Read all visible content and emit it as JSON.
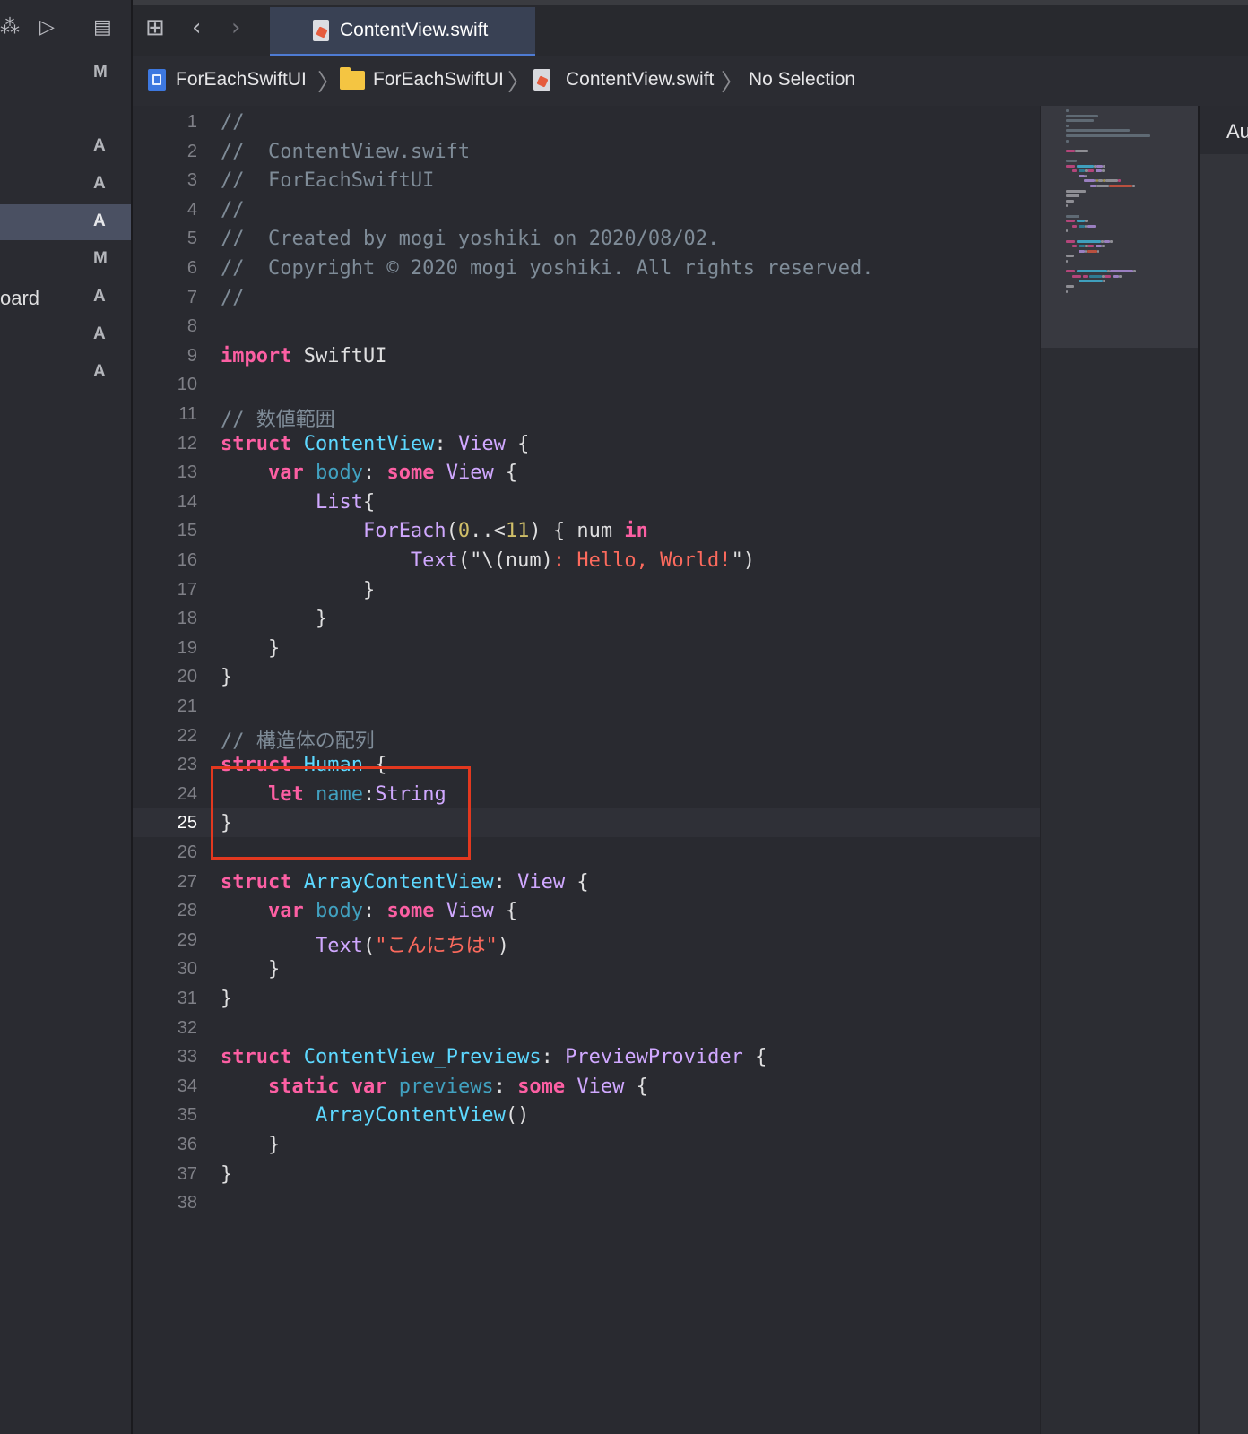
{
  "tab": {
    "title": "ContentView.swift"
  },
  "breadcrumb": {
    "project": "ForEachSwiftUI",
    "folder": "ForEachSwiftUI",
    "file": "ContentView.swift",
    "selection": "No Selection"
  },
  "navigator": {
    "files": [
      {
        "name": "",
        "status": "M"
      },
      {
        "name": "",
        "status": ""
      },
      {
        "name": "",
        "status": "A"
      },
      {
        "name": "",
        "status": "A"
      },
      {
        "name": "",
        "status": "A"
      },
      {
        "name": "",
        "status": "M"
      },
      {
        "name": "oard",
        "status": "A"
      },
      {
        "name": "",
        "status": "A"
      },
      {
        "name": "",
        "status": "A"
      }
    ],
    "selected_index": 4
  },
  "inspector": {
    "header": "Au"
  },
  "editor": {
    "current_line": 25,
    "lines": [
      {
        "n": "1",
        "t": [
          [
            "c-com",
            "//"
          ]
        ]
      },
      {
        "n": "2",
        "t": [
          [
            "c-com",
            "//  ContentView.swift"
          ]
        ]
      },
      {
        "n": "3",
        "t": [
          [
            "c-com",
            "//  ForEachSwiftUI"
          ]
        ]
      },
      {
        "n": "4",
        "t": [
          [
            "c-com",
            "//"
          ]
        ]
      },
      {
        "n": "5",
        "t": [
          [
            "c-com",
            "//  Created by mogi yoshiki on 2020/08/02."
          ]
        ]
      },
      {
        "n": "6",
        "t": [
          [
            "c-com",
            "//  Copyright © 2020 mogi yoshiki. All rights reserved."
          ]
        ]
      },
      {
        "n": "7",
        "t": [
          [
            "c-com",
            "//"
          ]
        ]
      },
      {
        "n": "8",
        "t": []
      },
      {
        "n": "9",
        "t": [
          [
            "c-kw",
            "import"
          ],
          [
            "c-plain",
            " SwiftUI"
          ]
        ]
      },
      {
        "n": "10",
        "t": []
      },
      {
        "n": "11",
        "t": [
          [
            "c-com",
            "// 数値範囲"
          ]
        ]
      },
      {
        "n": "12",
        "t": [
          [
            "c-kw",
            "struct"
          ],
          [
            "c-plain",
            " "
          ],
          [
            "c-type",
            "ContentView"
          ],
          [
            "c-plain",
            ": "
          ],
          [
            "c-sys",
            "View"
          ],
          [
            "c-plain",
            " {"
          ]
        ]
      },
      {
        "n": "13",
        "t": [
          [
            "c-plain",
            "    "
          ],
          [
            "c-kw",
            "var"
          ],
          [
            "c-plain",
            " "
          ],
          [
            "c-prop",
            "body"
          ],
          [
            "c-plain",
            ": "
          ],
          [
            "c-kw",
            "some"
          ],
          [
            "c-plain",
            " "
          ],
          [
            "c-sys",
            "View"
          ],
          [
            "c-plain",
            " {"
          ]
        ]
      },
      {
        "n": "14",
        "t": [
          [
            "c-plain",
            "        "
          ],
          [
            "c-sys",
            "List"
          ],
          [
            "c-plain",
            "{"
          ]
        ]
      },
      {
        "n": "15",
        "t": [
          [
            "c-plain",
            "            "
          ],
          [
            "c-sys",
            "ForEach"
          ],
          [
            "c-plain",
            "("
          ],
          [
            "c-num",
            "0"
          ],
          [
            "c-plain",
            "..<"
          ],
          [
            "c-num",
            "11"
          ],
          [
            "c-plain",
            ") { num "
          ],
          [
            "c-kw",
            "in"
          ]
        ]
      },
      {
        "n": "16",
        "t": [
          [
            "c-plain",
            "                "
          ],
          [
            "c-sys",
            "Text"
          ],
          [
            "c-plain",
            "(\"\\(num)"
          ],
          [
            "c-str",
            ": Hello, World!"
          ],
          [
            "c-plain",
            "\")"
          ]
        ]
      },
      {
        "n": "17",
        "t": [
          [
            "c-plain",
            "            }"
          ]
        ]
      },
      {
        "n": "18",
        "t": [
          [
            "c-plain",
            "        }"
          ]
        ]
      },
      {
        "n": "19",
        "t": [
          [
            "c-plain",
            "    }"
          ]
        ]
      },
      {
        "n": "20",
        "t": [
          [
            "c-plain",
            "}"
          ]
        ]
      },
      {
        "n": "21",
        "t": []
      },
      {
        "n": "22",
        "t": [
          [
            "c-com",
            "// 構造体の配列"
          ]
        ]
      },
      {
        "n": "23",
        "t": [
          [
            "c-kw",
            "struct"
          ],
          [
            "c-plain",
            " "
          ],
          [
            "c-type",
            "Human"
          ],
          [
            "c-plain",
            " {"
          ]
        ]
      },
      {
        "n": "24",
        "t": [
          [
            "c-plain",
            "    "
          ],
          [
            "c-kw",
            "let"
          ],
          [
            "c-plain",
            " "
          ],
          [
            "c-prop",
            "name"
          ],
          [
            "c-plain",
            ":"
          ],
          [
            "c-sys",
            "String"
          ]
        ]
      },
      {
        "n": "25",
        "t": [
          [
            "c-plain",
            "}"
          ]
        ]
      },
      {
        "n": "26",
        "t": []
      },
      {
        "n": "27",
        "t": [
          [
            "c-kw",
            "struct"
          ],
          [
            "c-plain",
            " "
          ],
          [
            "c-type",
            "ArrayContentView"
          ],
          [
            "c-plain",
            ": "
          ],
          [
            "c-sys",
            "View"
          ],
          [
            "c-plain",
            " {"
          ]
        ]
      },
      {
        "n": "28",
        "t": [
          [
            "c-plain",
            "    "
          ],
          [
            "c-kw",
            "var"
          ],
          [
            "c-plain",
            " "
          ],
          [
            "c-prop",
            "body"
          ],
          [
            "c-plain",
            ": "
          ],
          [
            "c-kw",
            "some"
          ],
          [
            "c-plain",
            " "
          ],
          [
            "c-sys",
            "View"
          ],
          [
            "c-plain",
            " {"
          ]
        ]
      },
      {
        "n": "29",
        "t": [
          [
            "c-plain",
            "        "
          ],
          [
            "c-sys",
            "Text"
          ],
          [
            "c-plain",
            "("
          ],
          [
            "c-str",
            "\"こんにちは\""
          ],
          [
            "c-plain",
            ")"
          ]
        ]
      },
      {
        "n": "30",
        "t": [
          [
            "c-plain",
            "    }"
          ]
        ]
      },
      {
        "n": "31",
        "t": [
          [
            "c-plain",
            "}"
          ]
        ]
      },
      {
        "n": "32",
        "t": []
      },
      {
        "n": "33",
        "t": [
          [
            "c-kw",
            "struct"
          ],
          [
            "c-plain",
            " "
          ],
          [
            "c-type",
            "ContentView_Previews"
          ],
          [
            "c-plain",
            ": "
          ],
          [
            "c-sys",
            "PreviewProvider"
          ],
          [
            "c-plain",
            " {"
          ]
        ]
      },
      {
        "n": "34",
        "t": [
          [
            "c-plain",
            "    "
          ],
          [
            "c-kw",
            "static"
          ],
          [
            "c-plain",
            " "
          ],
          [
            "c-kw",
            "var"
          ],
          [
            "c-plain",
            " "
          ],
          [
            "c-prop",
            "previews"
          ],
          [
            "c-plain",
            ": "
          ],
          [
            "c-kw",
            "some"
          ],
          [
            "c-plain",
            " "
          ],
          [
            "c-sys",
            "View"
          ],
          [
            "c-plain",
            " {"
          ]
        ]
      },
      {
        "n": "35",
        "t": [
          [
            "c-plain",
            "        "
          ],
          [
            "c-type",
            "ArrayContentView"
          ],
          [
            "c-plain",
            "()"
          ]
        ]
      },
      {
        "n": "36",
        "t": [
          [
            "c-plain",
            "    }"
          ]
        ]
      },
      {
        "n": "37",
        "t": [
          [
            "c-plain",
            "}"
          ]
        ]
      },
      {
        "n": "38",
        "t": []
      }
    ]
  },
  "colors": {
    "keyword": "#fc5fa3",
    "type_decl": "#5dd8ff",
    "type_system": "#d0a8ff",
    "property": "#41a1c0",
    "string": "#fc6a5d",
    "number": "#d0bf69",
    "comment": "#7f8c98",
    "highlight_box": "#e2381f"
  }
}
